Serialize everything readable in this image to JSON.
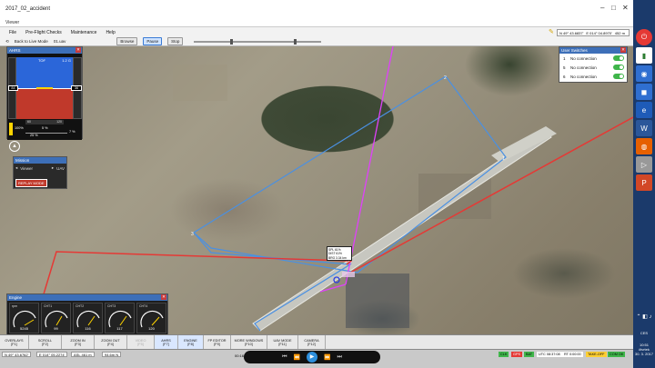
{
  "window": {
    "outer_title": "2017_02_accident",
    "app_title": "Viewer"
  },
  "menu": [
    "File",
    "Pre-Flight Checks",
    "Maintenance",
    "Help"
  ],
  "toolbar": {
    "back_label": "Back to Live Mode",
    "log_label": "01.uav",
    "browse_label": "Browse",
    "pause_label": "Pause",
    "stop_label": "Stop"
  },
  "coords": {
    "lat": "N 49° 43.6837'",
    "lon": "E 014° 04.8970'",
    "alt": "452 m"
  },
  "ahrs": {
    "title": "AHRS",
    "tof_label": "TOF",
    "tof_value": "1.2 G",
    "speed_value": "84",
    "alt_value": "36",
    "hdg_value": "100%",
    "throttle": "5 %",
    "flap": "7 %",
    "trim": "25 %",
    "scale_left": "60",
    "scale_right": "120"
  },
  "user_switches": {
    "title": "User Switches",
    "items": [
      {
        "num": "1",
        "label": "No connection"
      },
      {
        "num": "5",
        "label": "No connection"
      },
      {
        "num": "6",
        "label": "No connection"
      }
    ]
  },
  "mission": {
    "title": "Mission",
    "vehicle_label": "Viewer",
    "uav_label": "UAV",
    "replay_label": "REPLAY MODE"
  },
  "map_label": {
    "line1": "SPL 61%",
    "line2": "DIST 61%",
    "line3": "BRG 3.34 km"
  },
  "engine": {
    "title": "Engine",
    "gauges": [
      {
        "label": "rpm",
        "value": "5245"
      },
      {
        "label": "CHT1",
        "value": "99"
      },
      {
        "label": "CHT2",
        "value": "116"
      },
      {
        "label": "CHT3",
        "value": "117"
      },
      {
        "label": "CHT4",
        "value": "120"
      }
    ]
  },
  "fkeys": [
    {
      "label": "OVERLAYS",
      "key": "[F1]"
    },
    {
      "label": "SCROLL",
      "key": "[F2]"
    },
    {
      "label": "ZOOM IN",
      "key": "[F3]"
    },
    {
      "label": "ZOOM OUT",
      "key": "[F4]"
    },
    {
      "label": "VIDEO",
      "key": "[F5]"
    },
    {
      "label": "AHRS",
      "key": "[F7]"
    },
    {
      "label": "ENGINE",
      "key": "[F8]"
    },
    {
      "label": "FP EDITOR",
      "key": "[F9]"
    },
    {
      "label": "MORE WINDOWS",
      "key": "[F10]"
    },
    {
      "label": "UAV MODE",
      "key": "[F11]"
    },
    {
      "label": "CAMERA",
      "key": "[F12]"
    }
  ],
  "status": {
    "lat": "N 49° 43.6762'",
    "lon": "E 014° 05.2274'",
    "asl": "ASL 461 m",
    "dist": "94.6m N",
    "time": "00:16",
    "clk": "CLK",
    "gps": "GPS",
    "bat": "BAT",
    "utc": "UTC 08:37:08",
    "rt": "RT 0:00:00",
    "takeoff": "TAKE-OFF",
    "com": "COM OK"
  },
  "tray": {
    "lang": "CES",
    "time": "10:51",
    "day": "čtvrtek",
    "date": "30. 3. 2017"
  }
}
